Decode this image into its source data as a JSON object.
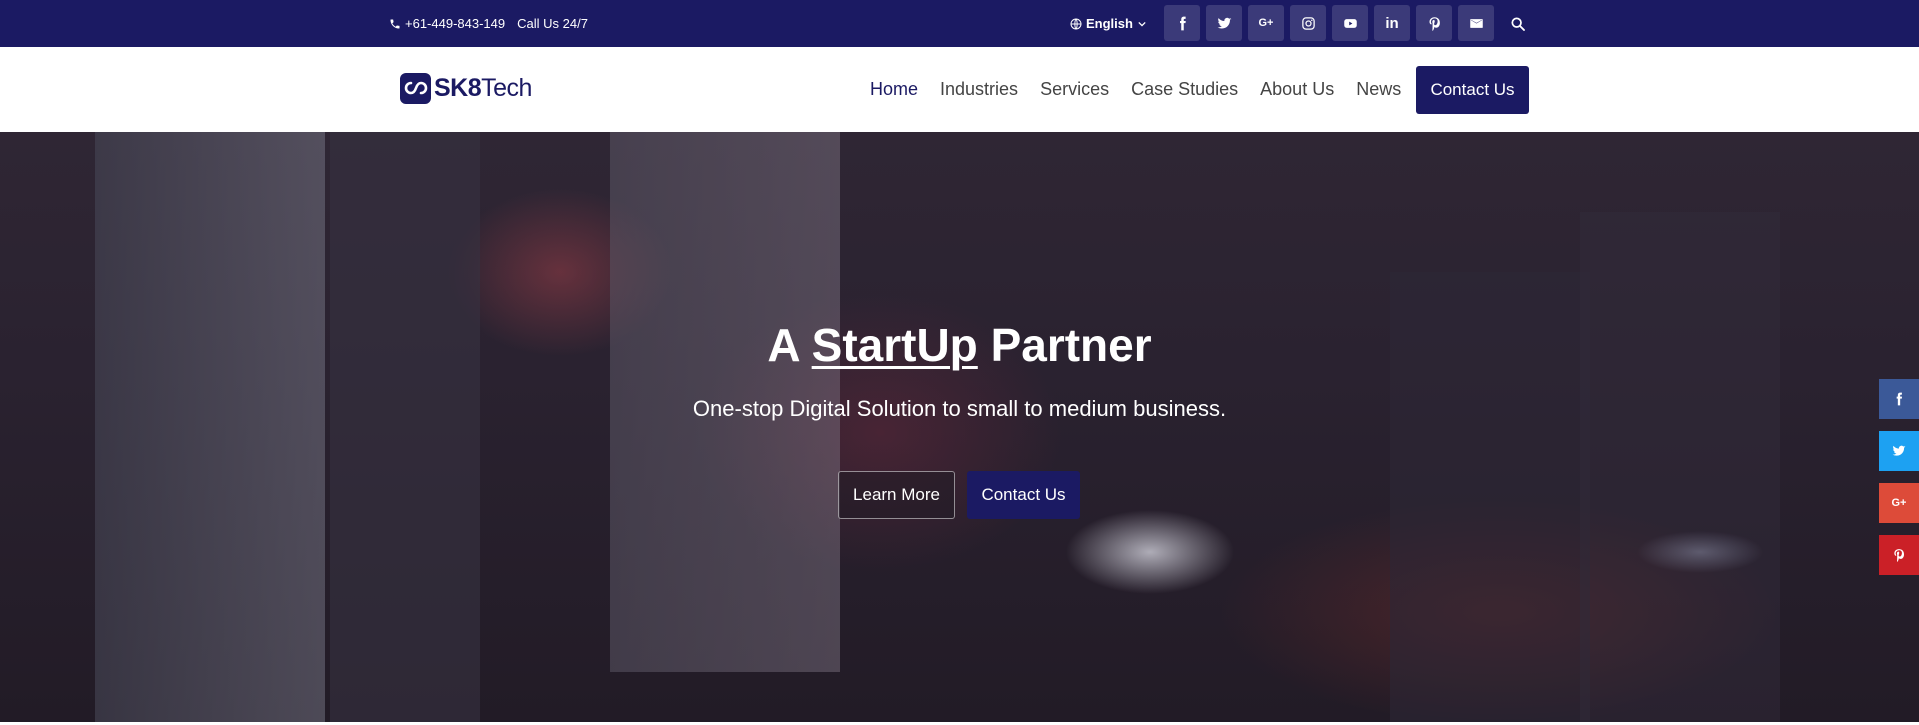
{
  "topbar": {
    "phone": "+61-449-843-149",
    "call_text": "Call Us 24/7",
    "language": "English",
    "social_icons": [
      "facebook-icon",
      "twitter-icon",
      "google-plus-icon",
      "instagram-icon",
      "youtube-icon",
      "linkedin-icon",
      "pinterest-icon",
      "email-icon"
    ],
    "google_plus_label": "G+",
    "linkedin_label": "in"
  },
  "header": {
    "logo_bold": "SK8",
    "logo_light": "Tech",
    "nav": [
      "Home",
      "Industries",
      "Services",
      "Case Studies",
      "About Us",
      "News"
    ],
    "contact_button": "Contact Us"
  },
  "hero": {
    "title_prefix": "A",
    "title_highlight": "StartUp",
    "title_suffix": "Partner",
    "subtitle": "One-stop Digital Solution to small to medium business.",
    "learn_more": "Learn More",
    "contact_button": "Contact Us"
  },
  "share_bar": {
    "google_plus_label": "G+"
  },
  "colors": {
    "brand": "#1b1a63",
    "facebook": "#3b5998",
    "twitter": "#1da1f2",
    "google_plus": "#dd4b39",
    "pinterest": "#cb2027"
  }
}
